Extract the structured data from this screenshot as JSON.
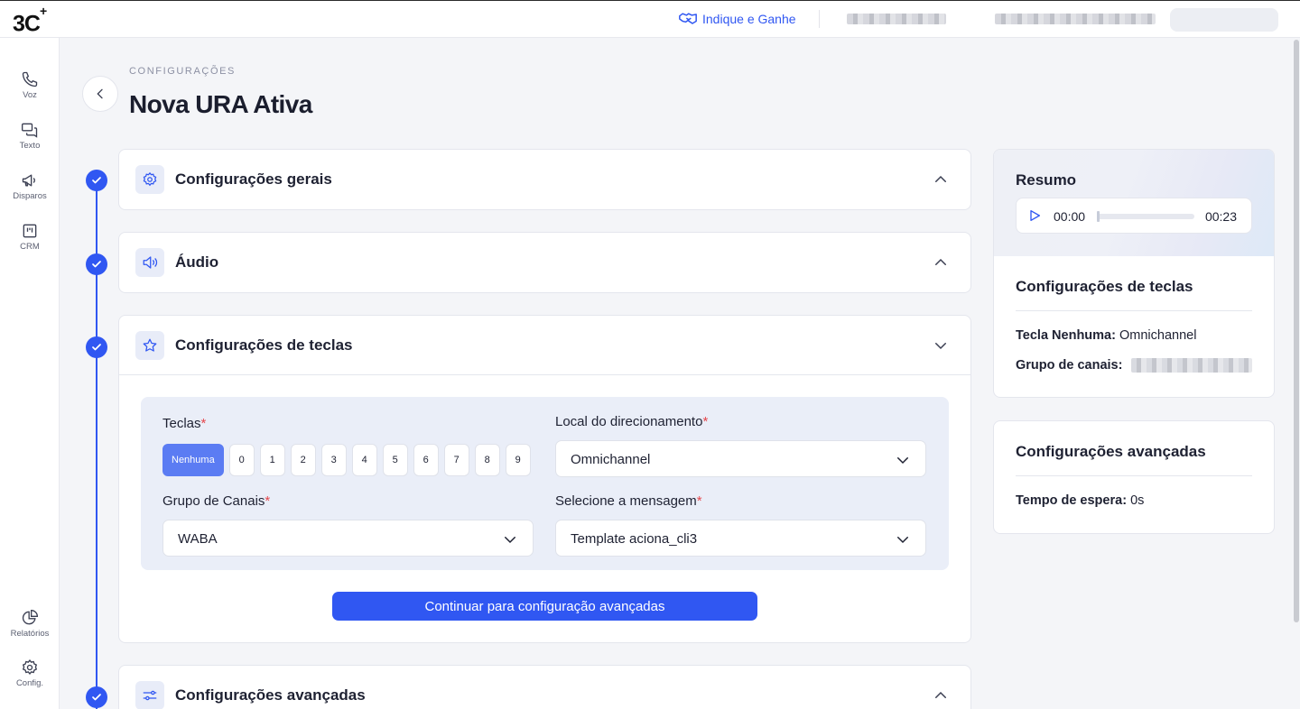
{
  "brand": {
    "logo": "3C",
    "logo_plus": "+"
  },
  "topbar": {
    "referral_label": "Indique e Ganhe"
  },
  "sidebar": {
    "items": [
      {
        "label": "Voz",
        "icon": "phone-icon"
      },
      {
        "label": "Texto",
        "icon": "chat-icon"
      },
      {
        "label": "Disparos",
        "icon": "megaphone-icon"
      },
      {
        "label": "CRM",
        "icon": "kanban-icon"
      },
      {
        "label": "Relatórios",
        "icon": "pie-chart-icon"
      },
      {
        "label": "Config.",
        "icon": "gear-icon"
      }
    ]
  },
  "header": {
    "breadcrumb": "CONFIGURAÇÕES",
    "title": "Nova URA Ativa"
  },
  "sections": {
    "general": {
      "title": "Configurações gerais",
      "icon": "gear-icon"
    },
    "audio": {
      "title": "Áudio",
      "icon": "speaker-icon"
    },
    "keys": {
      "title": "Configurações de teclas",
      "icon": "star-icon"
    },
    "advanced": {
      "title": "Configurações avançadas",
      "icon": "sliders-icon"
    }
  },
  "keys_form": {
    "keys_label": "Teclas",
    "keys": [
      "Nenhuma",
      "0",
      "1",
      "2",
      "3",
      "4",
      "5",
      "6",
      "7",
      "8",
      "9"
    ],
    "selected_key": "Nenhuma",
    "direction_label": "Local do direcionamento",
    "direction_value": "Omnichannel",
    "channels_label": "Grupo de Canais",
    "channels_value": "WABA",
    "message_label": "Selecione a mensagem",
    "message_value": "Template aciona_cli3",
    "required_mark": "*",
    "continue_label": "Continuar para configuração avançadas"
  },
  "summary": {
    "title": "Resumo",
    "player": {
      "current": "00:00",
      "duration": "00:23",
      "progress": 0
    },
    "keys_title": "Configurações de teclas",
    "key_label": "Tecla",
    "key_value": "Nenhuma",
    "key_dest": "Omnichannel",
    "channels_label": "Grupo de canais:",
    "advanced_title": "Configurações avançadas",
    "wait_label": "Tempo de espera:",
    "wait_value": "0s"
  },
  "colors": {
    "accent": "#3057f2",
    "key_active": "#5b7cf3",
    "required": "#e5484d"
  }
}
